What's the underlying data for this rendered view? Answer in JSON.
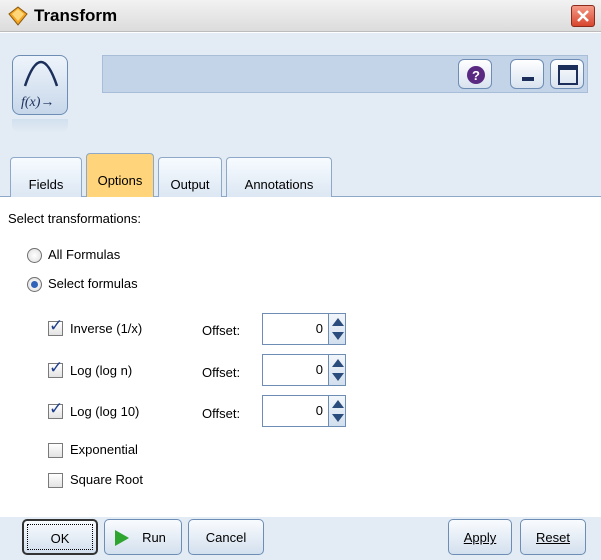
{
  "window": {
    "title": "Transform",
    "colors": {
      "title_bar": "#dcdcdc",
      "header_bg": "#e3ecf4",
      "active_tab": "#ffd47a",
      "close": "#d8452e",
      "run_green": "#2ea52e"
    },
    "icons": [
      "transform-node-icon",
      "help-icon",
      "minimize-icon",
      "maximize-icon",
      "close-icon"
    ]
  },
  "tabs": [
    {
      "label": "Fields",
      "active": false
    },
    {
      "label": "Options",
      "active": true
    },
    {
      "label": "Output",
      "active": false
    },
    {
      "label": "Annotations",
      "active": false
    }
  ],
  "options": {
    "section_label": "Select transformations:",
    "radios": [
      {
        "label": "All Formulas",
        "checked": false
      },
      {
        "label": "Select formulas",
        "checked": true
      }
    ],
    "formulas": [
      {
        "label": "Inverse (1/x)",
        "checked": true,
        "offset_label": "Offset:",
        "offset_value": "0"
      },
      {
        "label": "Log (log n)",
        "checked": true,
        "offset_label": "Offset:",
        "offset_value": "0"
      },
      {
        "label": "Log (log 10)",
        "checked": true,
        "offset_label": "Offset:",
        "offset_value": "0"
      },
      {
        "label": "Exponential",
        "checked": false
      },
      {
        "label": "Square Root",
        "checked": false
      }
    ]
  },
  "buttons": {
    "ok": "OK",
    "run": "Run",
    "cancel": "Cancel",
    "apply": "Apply",
    "reset": "Reset"
  }
}
